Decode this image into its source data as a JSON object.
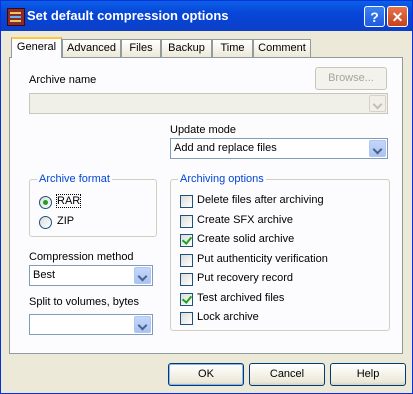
{
  "window": {
    "title": "Set default compression options"
  },
  "tabs": [
    "General",
    "Advanced",
    "Files",
    "Backup",
    "Time",
    "Comment"
  ],
  "general": {
    "archive_name_label": "Archive name",
    "archive_name_value": "",
    "browse_label": "Browse...",
    "update_mode_label": "Update mode",
    "update_mode_value": "Add and replace files",
    "archive_format_label": "Archive format",
    "formats": [
      {
        "label": "RAR",
        "selected": true
      },
      {
        "label": "ZIP",
        "selected": false
      }
    ],
    "compression_label": "Compression method",
    "compression_value": "Best",
    "split_label": "Split to volumes, bytes",
    "split_value": "",
    "archiving_options_label": "Archiving options",
    "options": [
      {
        "label": "Delete files after archiving",
        "checked": false
      },
      {
        "label": "Create SFX archive",
        "checked": false
      },
      {
        "label": "Create solid archive",
        "checked": true
      },
      {
        "label": "Put authenticity verification",
        "checked": false
      },
      {
        "label": "Put recovery record",
        "checked": false
      },
      {
        "label": "Test archived files",
        "checked": true
      },
      {
        "label": "Lock archive",
        "checked": false
      }
    ]
  },
  "buttons": {
    "ok": "OK",
    "cancel": "Cancel",
    "help": "Help"
  },
  "colors": {
    "titlebar": "#0a5fe8",
    "group_label": "#0046d5",
    "check_mark": "#21a121"
  }
}
